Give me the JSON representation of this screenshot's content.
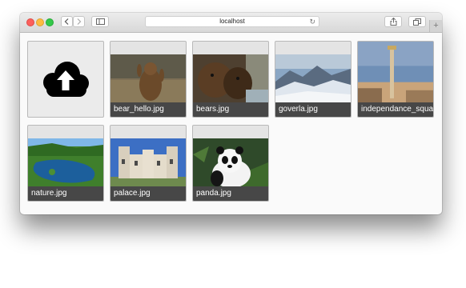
{
  "browser": {
    "url": "localhost",
    "back_icon": "chevron-left-icon",
    "forward_icon": "chevron-right-icon",
    "sidebar_icon": "sidebar-icon",
    "reload_icon": "reload-icon",
    "share_icon": "share-icon",
    "tabs_icon": "tabs-icon",
    "new_tab_label": "+"
  },
  "upload_tile": {
    "icon": "cloud-upload-icon"
  },
  "photos": [
    {
      "name": "bear_hello.jpg"
    },
    {
      "name": "bears.jpg"
    },
    {
      "name": "goverla.jpg"
    },
    {
      "name": "independance_square.jpg"
    },
    {
      "name": "nature.jpg"
    },
    {
      "name": "palace.jpg"
    },
    {
      "name": "panda.jpg"
    }
  ],
  "colors": {
    "label_background": "#474747",
    "tile_background": "#e4e4e4",
    "close_light": "#fc605c",
    "minimize_light": "#fdbc40",
    "zoom_light": "#34c84a"
  }
}
